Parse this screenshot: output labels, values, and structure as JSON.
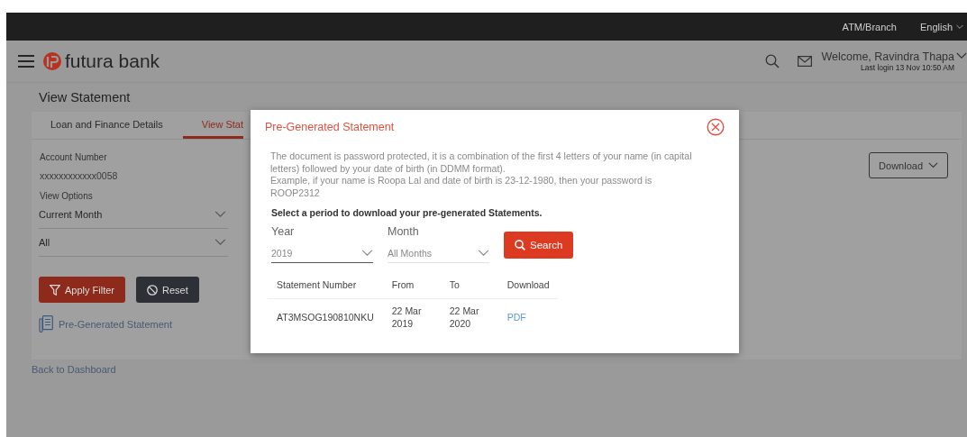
{
  "top_bar": {
    "links": [
      "ATM/Branch",
      "English"
    ]
  },
  "header": {
    "brand": "futura bank",
    "welcome": "Welcome, Ravindra Thapa",
    "last_login": "Last login 13 Nov 10:50 AM"
  },
  "page": {
    "title": "View Statement",
    "tabs": [
      {
        "label": "Loan and Finance Details",
        "selected": false
      },
      {
        "label": "View Stat",
        "selected": true
      }
    ],
    "account_label": "Account Number",
    "account_number": "xxxxxxxxxxxx0058",
    "view_options_label": "View Options",
    "dropdowns": [
      {
        "value": "Current Month"
      },
      {
        "value": "All"
      }
    ],
    "buttons": [
      {
        "kind": "apply",
        "label": "Apply Filter"
      },
      {
        "kind": "reset",
        "label": "Reset"
      }
    ],
    "pregenerated_link": "Pre-Generated Statement",
    "download_button": "Download",
    "back_link": "Back to Dashboard"
  },
  "dialog": {
    "title": "Pre-Generated Statement",
    "note": [
      "The document is password protected, it is a combination of the first 4 letters of your name (in capital letters) followed by your date of birth (in DDMM format).",
      "Example, if your name is Roopa Lal and date of birth is 23-12-1980, then your password is ROOP2312"
    ],
    "prompt": "Select a period to download your pre-generated Statements.",
    "fields": [
      {
        "label": "Year",
        "value": "2019",
        "focused": true
      },
      {
        "label": "Month",
        "value": "All Months",
        "focused": false
      }
    ],
    "search_button": "Search",
    "table": {
      "columns": [
        "Statement Number",
        "From",
        "To",
        "Download"
      ],
      "rows": [
        {
          "number": "AT3MSOG190810NKU",
          "from": "22 Mar 2019",
          "to": "22 Mar 2020",
          "download": "PDF"
        }
      ]
    }
  }
}
